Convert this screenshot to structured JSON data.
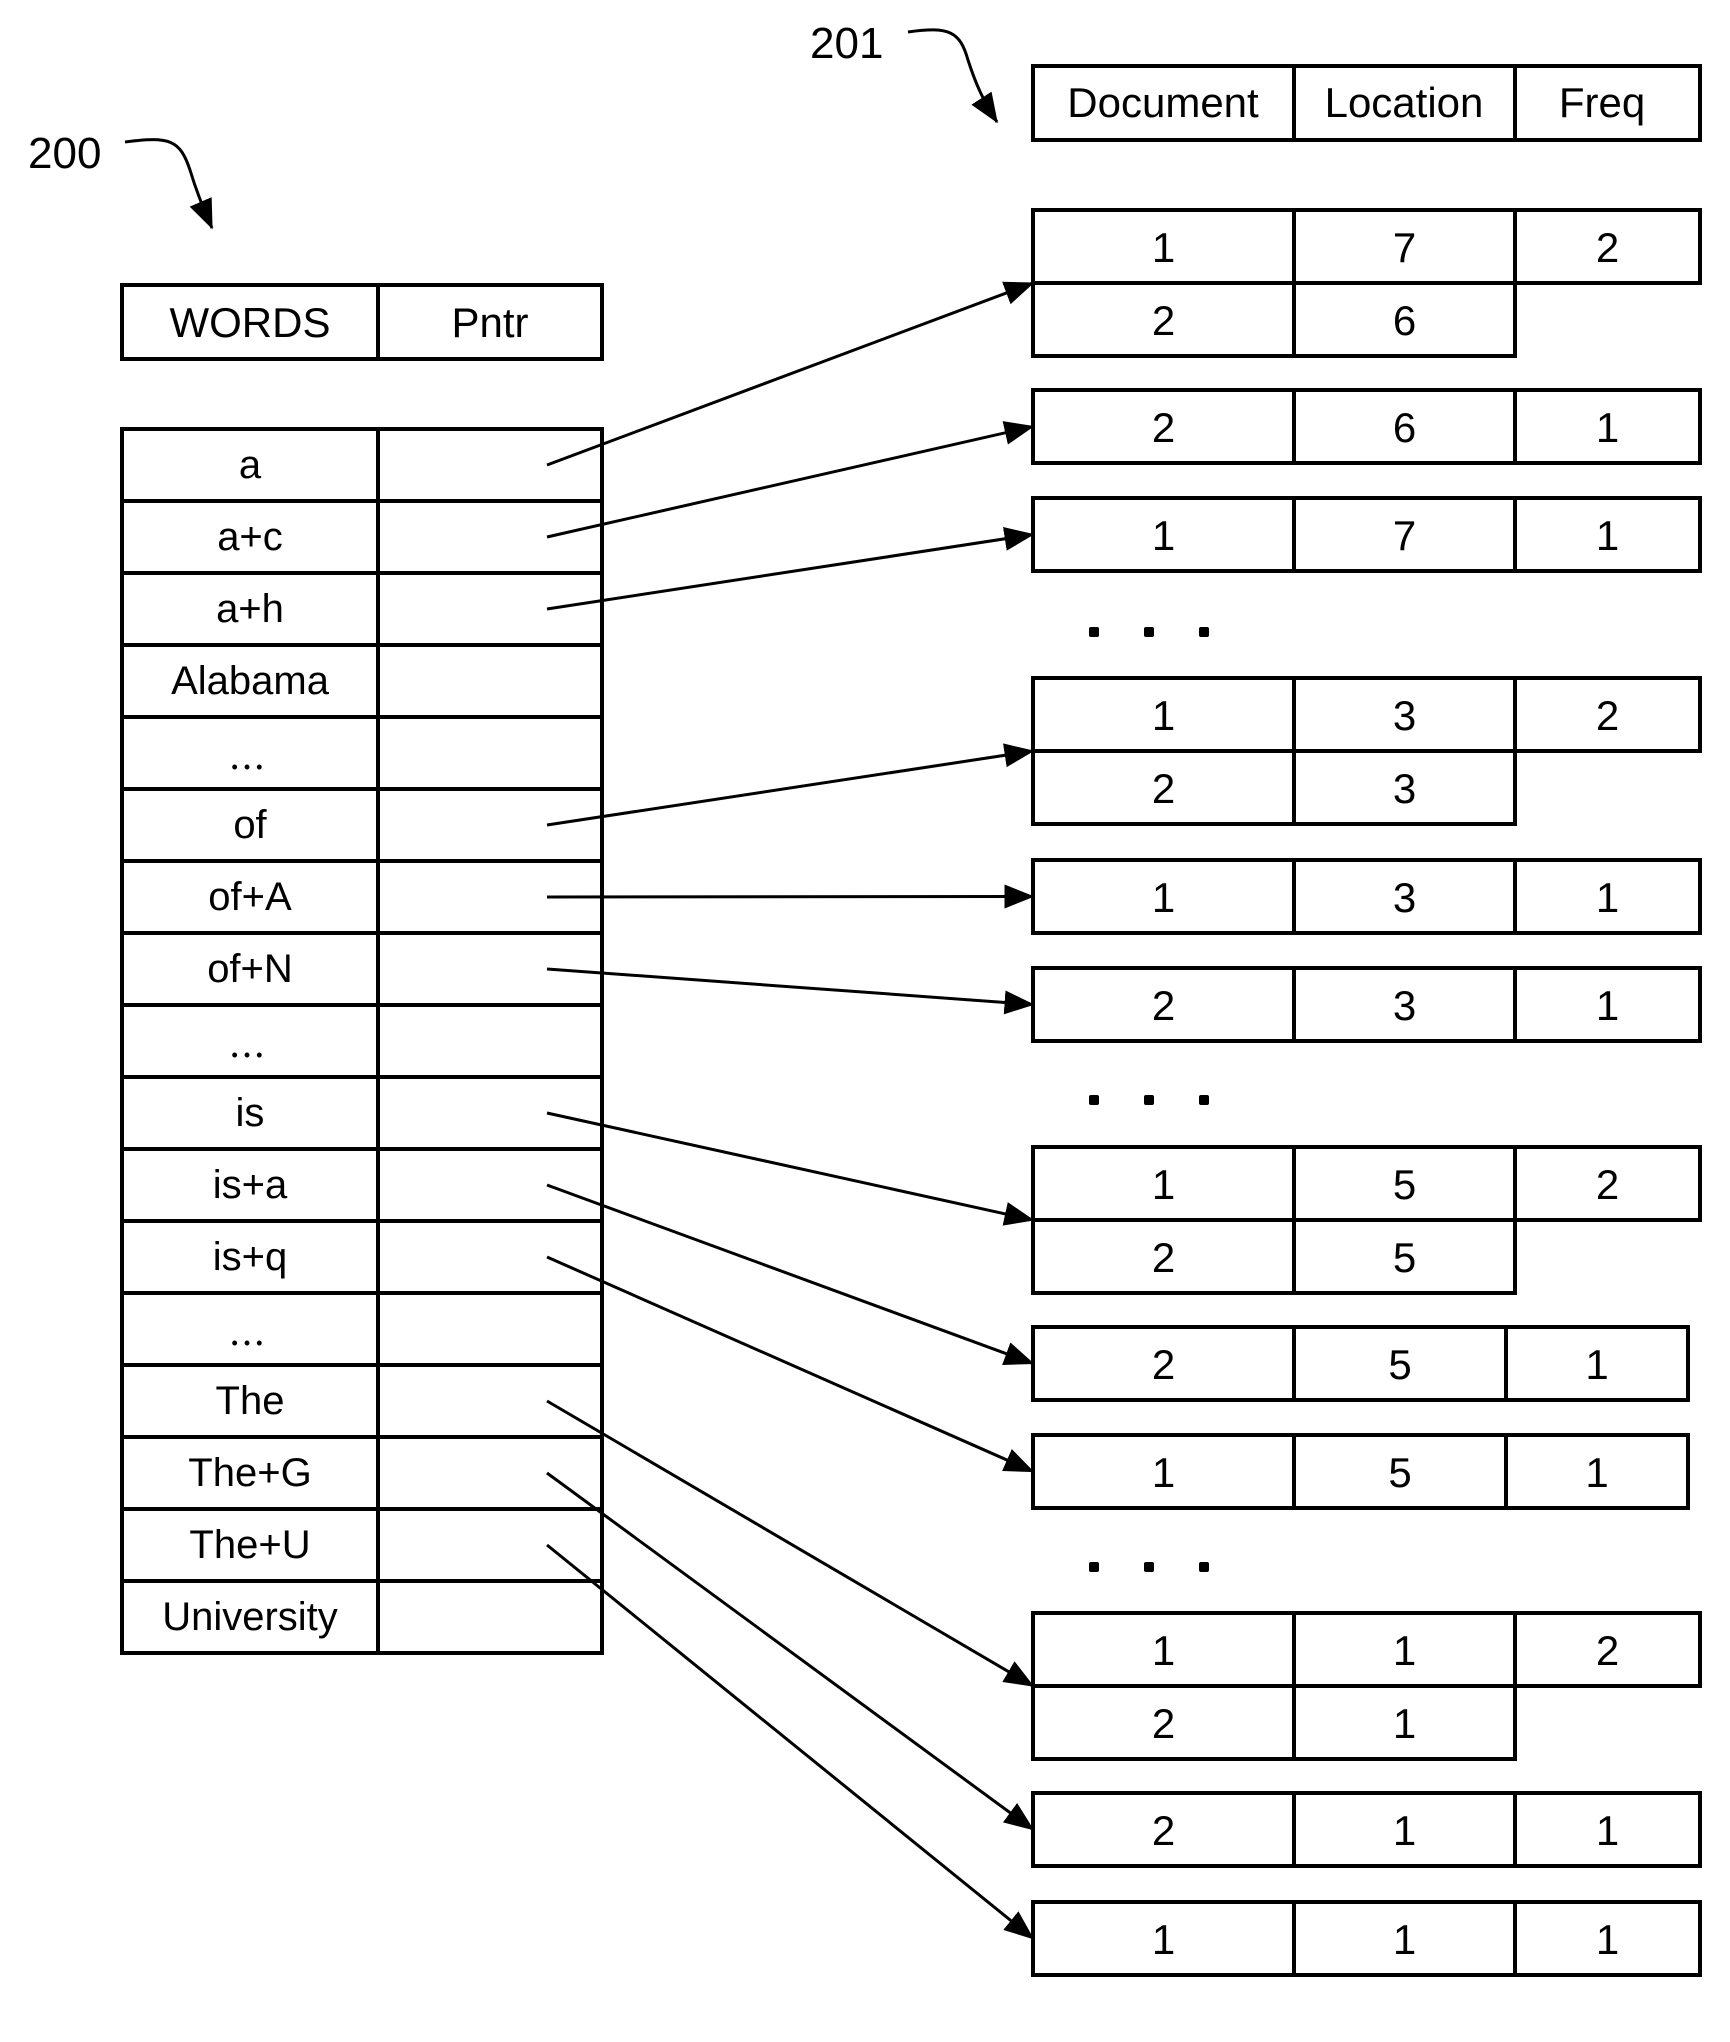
{
  "figure": {
    "word_table_ref": "200",
    "posting_table_ref": "201",
    "ink_color": "#000000",
    "background_color": "#ffffff"
  },
  "word_table": {
    "headers": [
      "WORDS",
      "Pntr"
    ],
    "rows": [
      {
        "word": "a",
        "points_to": 0
      },
      {
        "word": "a+c",
        "points_to": 1
      },
      {
        "word": "a+h",
        "points_to": 2
      },
      {
        "word": "Alabama",
        "points_to": null
      },
      {
        "word": "...",
        "points_to": null,
        "ellipsis": true
      },
      {
        "word": "of",
        "points_to": 3
      },
      {
        "word": "of+A",
        "points_to": 4
      },
      {
        "word": "of+N",
        "points_to": 5
      },
      {
        "word": "...",
        "points_to": null,
        "ellipsis": true
      },
      {
        "word": "is",
        "points_to": 6
      },
      {
        "word": "is+a",
        "points_to": 7
      },
      {
        "word": "is+q",
        "points_to": 8
      },
      {
        "word": "...",
        "points_to": null,
        "ellipsis": true
      },
      {
        "word": "The",
        "points_to": 9
      },
      {
        "word": "The+G",
        "points_to": 10
      },
      {
        "word": "The+U",
        "points_to": 11
      },
      {
        "word": "University",
        "points_to": null
      }
    ]
  },
  "posting_table": {
    "headers": [
      "Document",
      "Location",
      "Freq"
    ],
    "separator": "▪ ▪ ▪",
    "records": [
      {
        "freq": "2",
        "entries": [
          {
            "document": "1",
            "location": "7"
          },
          {
            "document": "2",
            "location": "6"
          }
        ]
      },
      {
        "freq": "1",
        "entries": [
          {
            "document": "2",
            "location": "6"
          }
        ]
      },
      {
        "freq": "1",
        "entries": [
          {
            "document": "1",
            "location": "7"
          }
        ]
      },
      {
        "freq": "2",
        "entries": [
          {
            "document": "1",
            "location": "3"
          },
          {
            "document": "2",
            "location": "3"
          }
        ]
      },
      {
        "freq": "1",
        "entries": [
          {
            "document": "1",
            "location": "3"
          }
        ]
      },
      {
        "freq": "1",
        "entries": [
          {
            "document": "2",
            "location": "3"
          }
        ]
      },
      {
        "freq": "2",
        "entries": [
          {
            "document": "1",
            "location": "5"
          },
          {
            "document": "2",
            "location": "5"
          }
        ]
      },
      {
        "freq": "1",
        "entries": [
          {
            "document": "2",
            "location": "5"
          }
        ]
      },
      {
        "freq": "1",
        "entries": [
          {
            "document": "1",
            "location": "5"
          }
        ]
      },
      {
        "freq": "2",
        "entries": [
          {
            "document": "1",
            "location": "1"
          },
          {
            "document": "2",
            "location": "1"
          }
        ]
      },
      {
        "freq": "1",
        "entries": [
          {
            "document": "2",
            "location": "1"
          }
        ]
      },
      {
        "freq": "1",
        "entries": [
          {
            "document": "1",
            "location": "1"
          }
        ]
      }
    ]
  }
}
